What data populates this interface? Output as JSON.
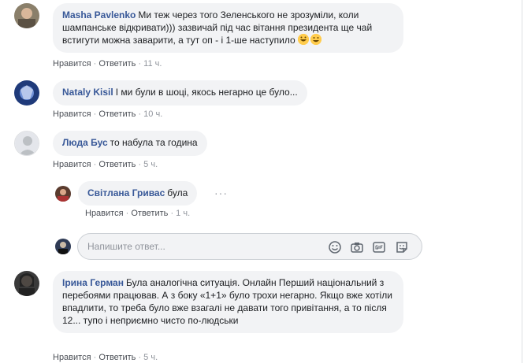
{
  "comments": [
    {
      "author": "Masha Pavlenko",
      "text": "Ми теж через того Зеленського не зрозуміли, коли шампанське відкривати))) зазвичай під час вітання президента ще чай встигути можна заварити, а тут оп - і 1-ше наступило",
      "actions": {
        "like": "Нравится",
        "reply": "Ответить",
        "time": "11 ч."
      }
    },
    {
      "author": "Nataly Kisil",
      "text": "І ми були в шоці, якось негарно це було...",
      "actions": {
        "like": "Нравится",
        "reply": "Ответить",
        "time": "10 ч."
      }
    },
    {
      "author": "Люда Бус",
      "text": "то набула та година",
      "actions": {
        "like": "Нравится",
        "reply": "Ответить",
        "time": "5 ч."
      }
    },
    {
      "author": "Світлана Гривас",
      "text": "була",
      "actions": {
        "like": "Нравится",
        "reply": "Ответить",
        "time": "1 ч."
      }
    },
    {
      "author": "Ірина Герман",
      "text": "Була аналогічна ситуація. Онлайн Перший національний з перебоями працював. А з боку «1+1» було трохи негарно. Якщо вже хотіли впадлити, то треба було вже взагалі не давати того привітання, а то після 12... тупо і неприємно чисто по-людськи",
      "actions": {
        "like": "Нравится",
        "reply": "Ответить",
        "time": "5 ч."
      }
    }
  ],
  "reply_box": {
    "placeholder": "Напишите ответ..."
  },
  "separator": "·",
  "more_glyph": "···",
  "colors": {
    "author": "#385898",
    "bubble": "#f2f3f5",
    "meta": "#90949c"
  }
}
